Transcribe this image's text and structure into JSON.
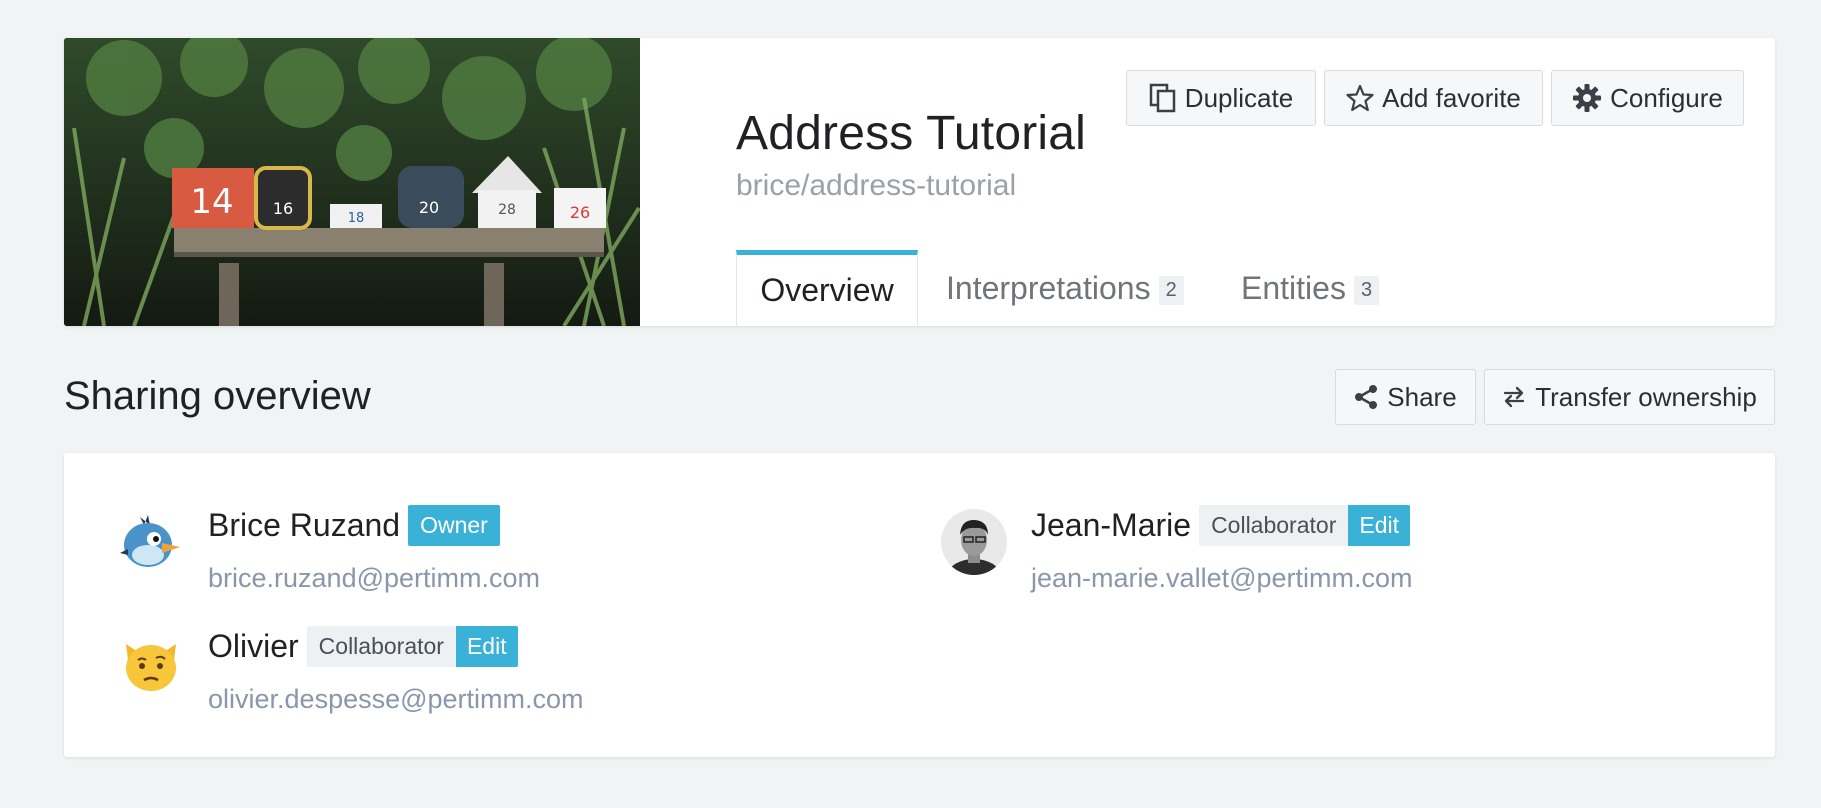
{
  "project": {
    "title": "Address Tutorial",
    "slug": "brice/address-tutorial"
  },
  "actions": {
    "duplicate": "Duplicate",
    "favorite": "Add favorite",
    "configure": "Configure"
  },
  "tabs": [
    {
      "label": "Overview",
      "active": true
    },
    {
      "label": "Interpretations",
      "count": "2"
    },
    {
      "label": "Entities",
      "count": "3"
    }
  ],
  "sharing": {
    "title": "Sharing overview",
    "share_label": "Share",
    "transfer_label": "Transfer ownership",
    "members": [
      {
        "name": "Brice Ruzand",
        "role": "Owner",
        "email": "brice.ruzand@pertimm.com",
        "avatar": "blue-bird-avatar"
      },
      {
        "name": "Jean-Marie",
        "role": "Collaborator",
        "permission": "Edit",
        "email": "jean-marie.vallet@pertimm.com",
        "avatar": "person-photo-avatar"
      },
      {
        "name": "Olivier",
        "role": "Collaborator",
        "permission": "Edit",
        "email": "olivier.despesse@pertimm.com",
        "avatar": "cat-face-avatar"
      }
    ]
  },
  "cover": {
    "mailbox_numbers": [
      "14",
      "16",
      "18",
      "20",
      "28",
      "26"
    ]
  },
  "colors": {
    "accent": "#3ab1d6",
    "background": "#f1f4f5",
    "muted_text": "#9aa1a9",
    "email_text": "#8a97aa"
  },
  "icons": {
    "duplicate": "copy-icon",
    "favorite": "star-icon",
    "configure": "gear-icon",
    "share": "share-icon",
    "transfer": "swap-arrows-icon"
  }
}
